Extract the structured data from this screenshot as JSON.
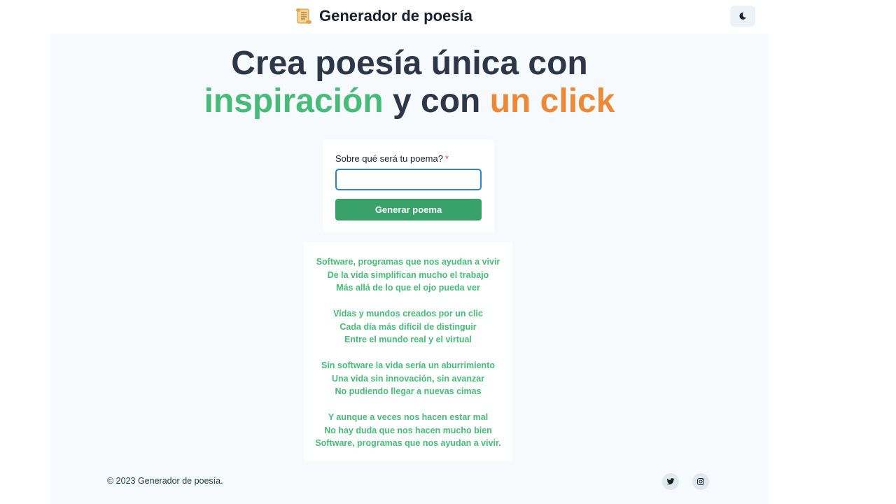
{
  "header": {
    "title": "Generador de poesía",
    "brand_icon": "scroll-icon",
    "theme_toggle_icon": "moon-icon"
  },
  "hero": {
    "line1": "Crea poesía única con",
    "highlight_green": "inspiración",
    "middle": " y con ",
    "highlight_orange": "un click",
    "colors": {
      "green": "#48bb78",
      "orange": "#ed8936",
      "dark": "#2d3748"
    }
  },
  "form": {
    "label": "Sobre qué será tu poema?",
    "required_mark": "*",
    "input_value": "",
    "button_label": "Generar poema",
    "button_color": "#38a169"
  },
  "poem": {
    "stanzas": [
      [
        "Software, programas que nos ayudan a vivir",
        "De la vida simplifican mucho el trabajo",
        "Más allá de lo que el ojo pueda ver"
      ],
      [
        "Vidas y mundos creados por un clic",
        "Cada día más difícil de distinguir",
        "Entre el mundo real y el virtual"
      ],
      [
        "Sin software la vida sería un aburrimiento",
        "Una vida sin innovación, sin avanzar",
        "No pudiendo llegar a nuevas cimas"
      ],
      [
        "Y aunque a veces nos hacen estar mal",
        "No hay duda que nos hacen mucho bien",
        "Software, programas que nos ayudan a vivir."
      ]
    ],
    "text_color": "#48bb78"
  },
  "footer": {
    "copyright": "© 2023 Generador de poesía.",
    "social": [
      "twitter-icon",
      "instagram-icon"
    ]
  }
}
